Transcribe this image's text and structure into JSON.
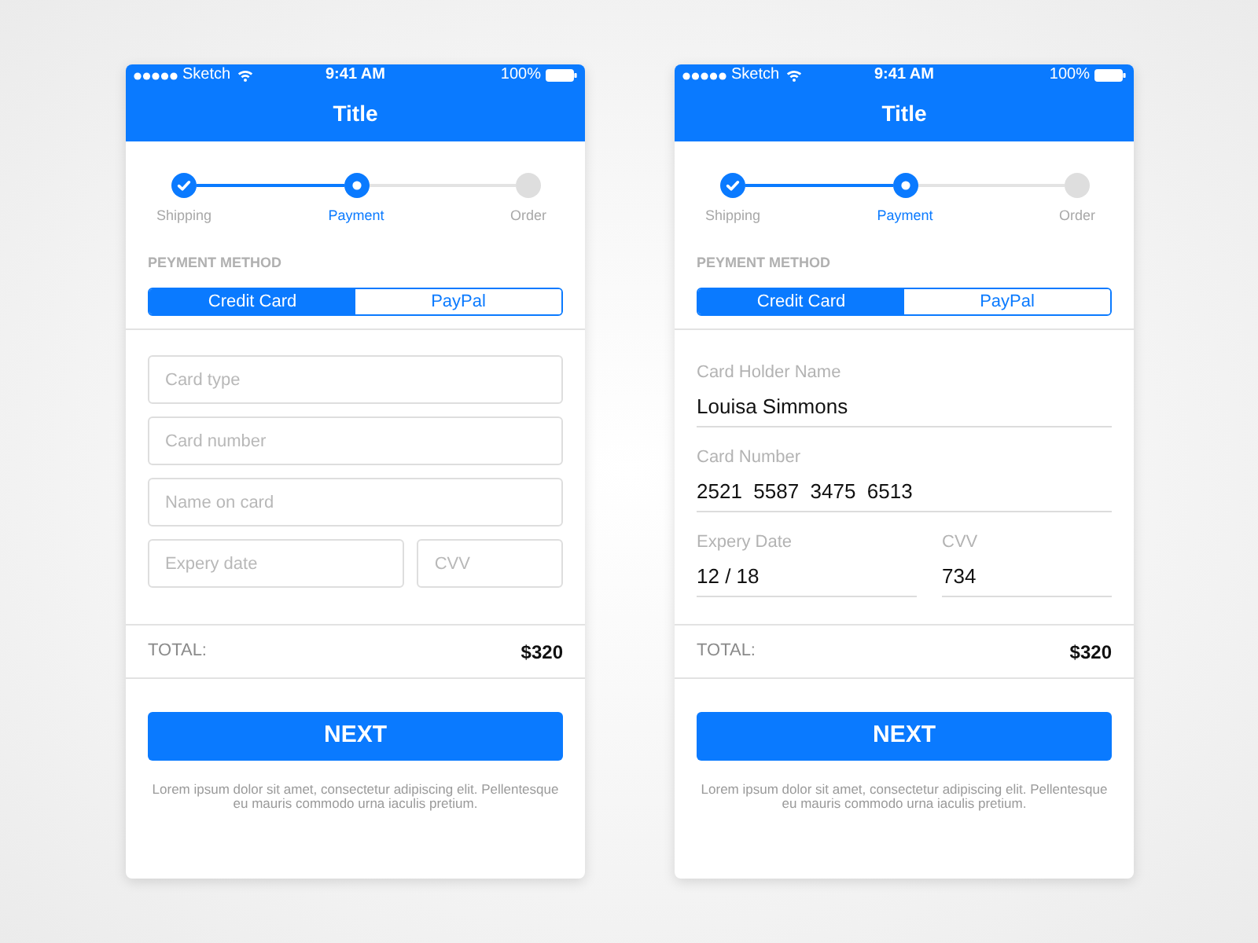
{
  "screens": [
    {
      "status_bar": {
        "carrier": "Sketch",
        "time": "9:41 AM",
        "battery": "100%"
      },
      "title": "Title",
      "steps": [
        {
          "label": "Shipping",
          "completed": true,
          "selected": false
        },
        {
          "label": "Payment",
          "completed": false,
          "selected": true
        },
        {
          "label": "Order",
          "completed": false,
          "selected": false
        }
      ],
      "section_label": "PEYMENT METHOD",
      "payment_tabs": [
        {
          "label": "Credit Card",
          "selected": true
        },
        {
          "label": "PayPal",
          "selected": false
        }
      ],
      "form": {
        "kind": "boxed",
        "rows": [
          {
            "fields": [
              {
                "placeholder": "Card type"
              }
            ]
          },
          {
            "fields": [
              {
                "placeholder": "Card number"
              }
            ]
          },
          {
            "fields": [
              {
                "placeholder": "Name on card"
              }
            ]
          },
          {
            "fields": [
              {
                "placeholder": "Expery date"
              },
              {
                "placeholder": "CVV"
              }
            ]
          }
        ]
      },
      "total": {
        "label": "TOTAL:",
        "amount": "$320"
      },
      "next_button": "NEXT",
      "footnote": "Lorem ipsum dolor sit amet, consectetur adipiscing elit. Pellentesque eu mauris commodo urna iaculis pretium."
    },
    {
      "status_bar": {
        "carrier": "Sketch",
        "time": "9:41 AM",
        "battery": "100%"
      },
      "title": "Title",
      "steps": [
        {
          "label": "Shipping",
          "completed": true,
          "selected": false
        },
        {
          "label": "Payment",
          "completed": false,
          "selected": true
        },
        {
          "label": "Order",
          "completed": false,
          "selected": false
        }
      ],
      "section_label": "PEYMENT METHOD",
      "payment_tabs": [
        {
          "label": "Credit Card",
          "selected": true
        },
        {
          "label": "PayPal",
          "selected": false
        }
      ],
      "form": {
        "kind": "underlined",
        "rows": [
          {
            "fields": [
              {
                "label": "Card Holder Name",
                "value": "Louisa Simmons"
              }
            ]
          },
          {
            "fields": [
              {
                "label": "Card Number",
                "value": "2521  5587  3475  6513"
              }
            ]
          },
          {
            "fields": [
              {
                "label": "Expery Date",
                "value": "12 / 18"
              },
              {
                "label": "CVV",
                "value": "734"
              }
            ]
          }
        ]
      },
      "total": {
        "label": "TOTAL:",
        "amount": "$320"
      },
      "next_button": "NEXT",
      "footnote": "Lorem ipsum dolor sit amet, consectetur adipiscing elit. Pellentesque eu mauris commodo urna iaculis pretium."
    }
  ]
}
